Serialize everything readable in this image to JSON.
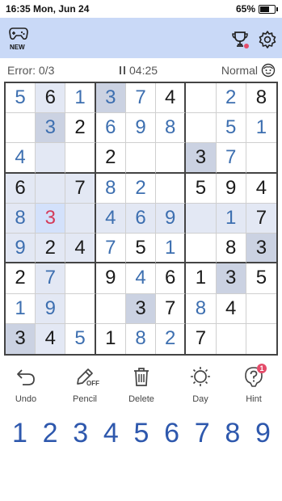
{
  "status_bar": {
    "time_date": "16:35  Mon, Jun 24",
    "battery": "65%"
  },
  "header": {
    "new_badge": "NEW",
    "icons": [
      "gamepad-icon",
      "trophy-icon",
      "settings-icon"
    ]
  },
  "info": {
    "error_label": "Error: 0/3",
    "timer": "04:25",
    "difficulty": "Normal"
  },
  "board": {
    "values": [
      [
        5,
        6,
        1,
        3,
        7,
        4,
        0,
        2,
        8
      ],
      [
        0,
        3,
        2,
        6,
        9,
        8,
        0,
        5,
        1
      ],
      [
        4,
        0,
        0,
        2,
        0,
        0,
        3,
        7,
        0
      ],
      [
        6,
        0,
        7,
        8,
        2,
        0,
        5,
        9,
        4
      ],
      [
        8,
        3,
        0,
        4,
        6,
        9,
        0,
        1,
        7
      ],
      [
        9,
        2,
        4,
        7,
        5,
        1,
        0,
        8,
        3
      ],
      [
        2,
        7,
        0,
        9,
        4,
        6,
        1,
        3,
        5
      ],
      [
        1,
        9,
        0,
        0,
        3,
        7,
        8,
        4,
        0
      ],
      [
        3,
        4,
        5,
        1,
        8,
        2,
        7,
        0,
        0
      ]
    ],
    "kinds": [
      [
        "e",
        "g",
        "e",
        "e",
        "e",
        "g",
        "",
        "e",
        "g"
      ],
      [
        "",
        "e",
        "g",
        "e",
        "e",
        "e",
        "",
        "e",
        "e"
      ],
      [
        "e",
        "",
        "",
        "g",
        "",
        "",
        "g",
        "e",
        ""
      ],
      [
        "g",
        "",
        "g",
        "e",
        "e",
        "",
        "g",
        "g",
        "g"
      ],
      [
        "e",
        "w",
        "",
        "e",
        "e",
        "e",
        "",
        "e",
        "g"
      ],
      [
        "e",
        "g",
        "g",
        "e",
        "g",
        "e",
        "",
        "g",
        "g"
      ],
      [
        "g",
        "e",
        "",
        "g",
        "e",
        "g",
        "g",
        "g",
        "g"
      ],
      [
        "e",
        "e",
        "",
        "",
        "g",
        "g",
        "e",
        "g",
        ""
      ],
      [
        "g",
        "g",
        "e",
        "g",
        "e",
        "e",
        "g",
        "",
        ""
      ]
    ],
    "highlight": [
      [
        "",
        "hl",
        "",
        "same",
        "",
        "",
        "",
        "",
        ""
      ],
      [
        "",
        "same",
        "",
        "",
        "",
        "",
        "",
        "",
        ""
      ],
      [
        "",
        "hl",
        "",
        "",
        "",
        "",
        "same",
        "",
        ""
      ],
      [
        "hl",
        "hl",
        "hl",
        "",
        "",
        "",
        "",
        "",
        ""
      ],
      [
        "hl",
        "sel",
        "hl",
        "hl",
        "hl",
        "hl",
        "hl",
        "hl",
        "hl"
      ],
      [
        "hl",
        "hl",
        "hl",
        "",
        "",
        "",
        "",
        "",
        "same"
      ],
      [
        "",
        "hl",
        "",
        "",
        "",
        "",
        "",
        "same",
        ""
      ],
      [
        "",
        "hl",
        "",
        "",
        "same",
        "",
        "",
        "",
        ""
      ],
      [
        "same",
        "hl",
        "",
        "",
        "",
        "",
        "",
        "",
        ""
      ]
    ],
    "selected": {
      "row": 5,
      "col": 2,
      "value": 3
    }
  },
  "tools": [
    {
      "label": "Undo",
      "icon": "undo-icon"
    },
    {
      "label": "Pencil",
      "icon": "pencil-icon",
      "state": "OFF"
    },
    {
      "label": "Delete",
      "icon": "trash-icon"
    },
    {
      "label": "Day",
      "icon": "sun-icon"
    },
    {
      "label": "Hint",
      "icon": "hint-icon",
      "badge": "1"
    }
  ],
  "numpad": [
    "1",
    "2",
    "3",
    "4",
    "5",
    "6",
    "7",
    "8",
    "9"
  ],
  "colors": {
    "appbar": "#c9d9f7",
    "entered": "#3d6fb0",
    "numpad": "#2e58ad",
    "error": "#d43b5a",
    "badge": "#e44c6a"
  }
}
